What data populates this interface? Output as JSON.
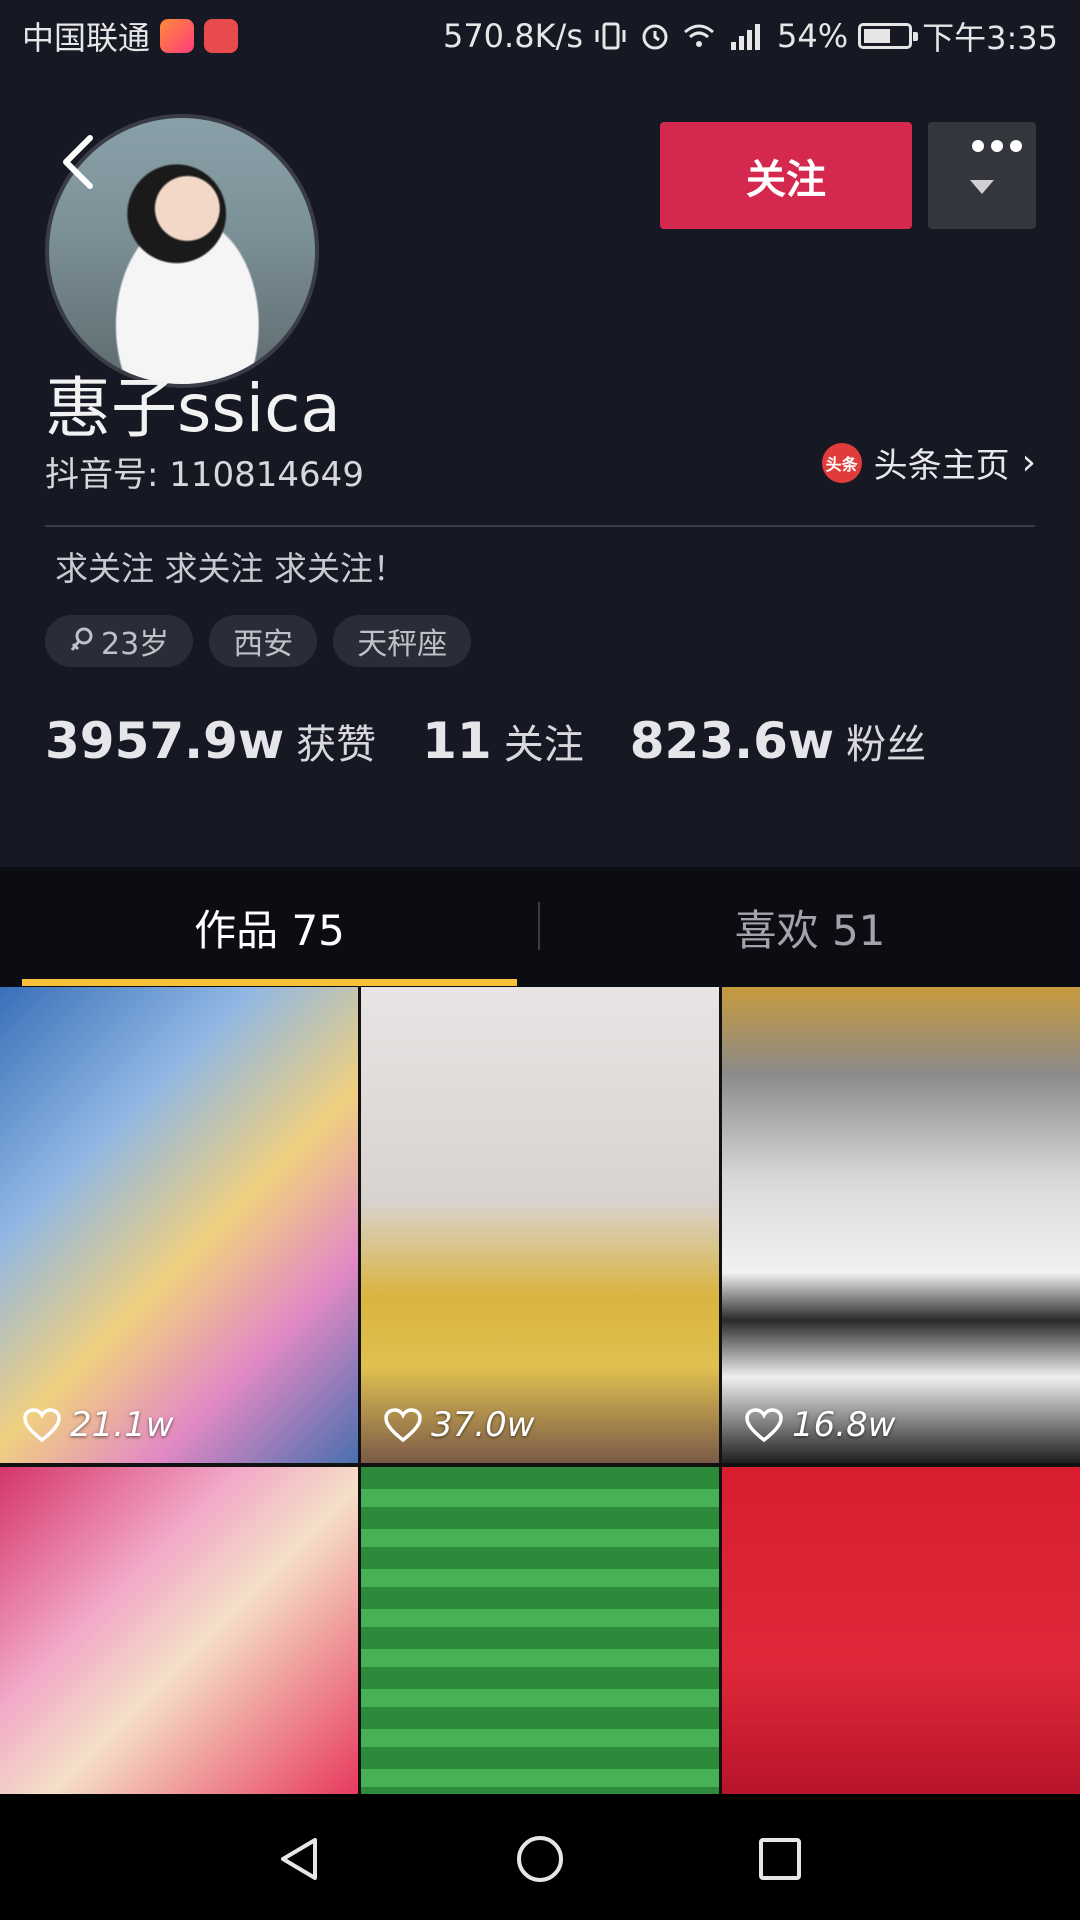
{
  "status_bar": {
    "carrier": "中国联通",
    "speed": "570.8K/s",
    "battery": "54%",
    "time": "下午3:35"
  },
  "profile": {
    "name": "惠子ssica",
    "douyin_id": "抖音号: 110814649",
    "toutiao_icon_text": "头条",
    "toutiao_link": "头条主页",
    "bio": "求关注 求关注 求关注！",
    "follow_button": "关注",
    "tags": [
      "23岁",
      "西安",
      "天秤座"
    ]
  },
  "stats": [
    {
      "value": "3957.9w",
      "label": "获赞"
    },
    {
      "value": "11",
      "label": "关注"
    },
    {
      "value": "823.6w",
      "label": "粉丝"
    }
  ],
  "tabs": {
    "works": "作品 75",
    "likes": "喜欢 51"
  },
  "videos": [
    {
      "likes": "21.1w"
    },
    {
      "likes": "37.0w"
    },
    {
      "likes": "16.8w"
    }
  ],
  "colors": {
    "accent": "#d4284f",
    "tab_indicator": "#f7c23a",
    "background": "#161824"
  }
}
